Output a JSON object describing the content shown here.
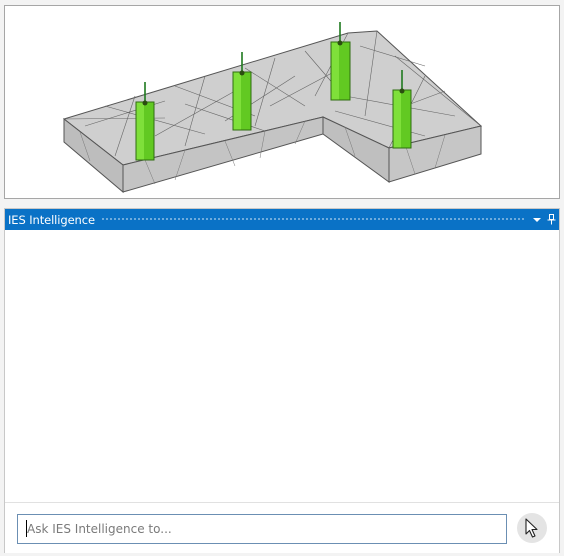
{
  "panel": {
    "title": "IES Intelligence",
    "dropdown_icon": "chevron-down-icon",
    "pin_icon": "pin-icon"
  },
  "input": {
    "placeholder": "Ask IES Intelligence to...",
    "value": ""
  },
  "send_button": {
    "icon": "cursor-send-icon"
  },
  "colors": {
    "header_bg": "#0a72c6",
    "column_green": "#5ec81f",
    "slab_gray": "#c9c9c9",
    "rebar_green": "#1e7a1e"
  }
}
